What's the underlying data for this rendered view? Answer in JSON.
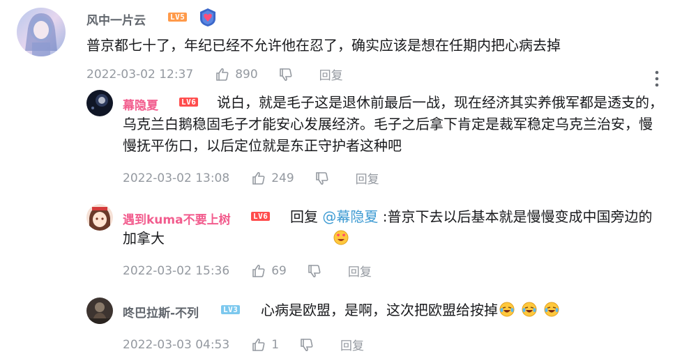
{
  "main_comment": {
    "username": "风中一片云",
    "level": "LV5",
    "text": "普京都七十了，年纪已经不允许他在忍了，确实应该是想在任期内把心病去掉",
    "timestamp": "2022-03-02 12:37",
    "likes": "890",
    "reply_label": "回复"
  },
  "replies": [
    {
      "username": "幕隐夏",
      "level": "LV6",
      "text": "说白，就是毛子这是退休前最后一战，现在经济其实养俄军都是透支的，乌克兰白鹅稳固毛子才能安心发展经济。毛子之后拿下肯定是裁军稳定乌克兰治安，慢慢抚平伤口，以后定位就是东正守护者这种吧",
      "timestamp": "2022-03-02 13:08",
      "likes": "249",
      "reply_label": "回复"
    },
    {
      "username": "遇到kuma不要上树",
      "level": "LV6",
      "reply_prefix": "回复 ",
      "mention": "@幕隐夏",
      "text": " :普京下去以后基本就是慢慢变成中国旁边的加拿大",
      "timestamp": "2022-03-02 15:36",
      "likes": "69",
      "reply_label": "回复"
    },
    {
      "username": "咚巴拉斯-不列",
      "level": "LV3",
      "text": "心病是欧盟，是啊，这次把欧盟给按掉",
      "timestamp": "2022-03-03 04:53",
      "likes": "1",
      "reply_label": "回复"
    }
  ],
  "colors": {
    "meta_gray": "#9499a0",
    "mention_blue": "#3e9bd3",
    "pink_name": "#f25d8e",
    "text": "#18191c"
  }
}
